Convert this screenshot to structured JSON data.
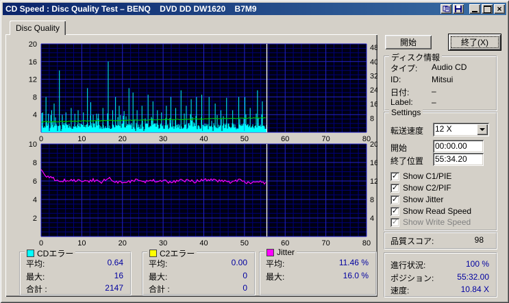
{
  "window": {
    "title": "CD Speed : Disc Quality Test – BENQ    DVD DD DW1620    B7M9"
  },
  "titlebar": {
    "buttons": [
      "book",
      "save",
      "minimize",
      "maximize",
      "close"
    ]
  },
  "tab": {
    "label": "Disc Quality"
  },
  "actions": {
    "start_label": "開始",
    "exit_label": "終了(X)"
  },
  "disc_info": {
    "title": "ディスク情報",
    "rows": [
      {
        "label": "タイプ:",
        "value": "Audio CD"
      },
      {
        "label": "ID:",
        "value": "Mitsui"
      },
      {
        "label": "日付:",
        "value": "–"
      },
      {
        "label": "Label:",
        "value": "–"
      }
    ]
  },
  "settings": {
    "title": "Settings",
    "speed_label": "転送速度",
    "speed_value": "12 X",
    "start_label": "開始",
    "start_value": "00:00.00",
    "end_label": "終了位置",
    "end_value": "55:34.20",
    "checkboxes": [
      {
        "label": "Show C1/PIE",
        "checked": true,
        "enabled": true
      },
      {
        "label": "Show C2/PIF",
        "checked": true,
        "enabled": true
      },
      {
        "label": "Show Jitter",
        "checked": true,
        "enabled": true
      },
      {
        "label": "Show Read Speed",
        "checked": true,
        "enabled": true
      },
      {
        "label": "Show Write Speed",
        "checked": true,
        "enabled": false
      }
    ]
  },
  "quality": {
    "label": "品質スコア:",
    "value": "98"
  },
  "progress": {
    "rows": [
      {
        "label": "進行状況:",
        "value": "100 %"
      },
      {
        "label": "ポジション:",
        "value": "55:32.00"
      },
      {
        "label": "速度:",
        "value": "10.84 X"
      }
    ]
  },
  "legends": [
    {
      "title": "CDエラー",
      "swatch": "#00ffff",
      "rows": [
        {
          "label": "平均:",
          "value": "0.64"
        },
        {
          "label": "最大:",
          "value": "16"
        },
        {
          "label": "合計 :",
          "value": "2147"
        }
      ]
    },
    {
      "title": "C2エラー",
      "swatch": "#ffff00",
      "rows": [
        {
          "label": "平均:",
          "value": "0.00"
        },
        {
          "label": "最大:",
          "value": "0"
        },
        {
          "label": "合計 :",
          "value": "0"
        }
      ]
    },
    {
      "title": "Jitter",
      "swatch": "#ff00ff",
      "rows": [
        {
          "label": "平均:",
          "value": "11.46 %"
        },
        {
          "label": "最大:",
          "value": "16.0 %"
        }
      ]
    }
  ],
  "chart_colors": {
    "plot_bg": "#000014",
    "grid_minor": "#000078",
    "grid_major": "#2222c8",
    "bars": "#00ffff",
    "read_speed": "#00c000",
    "jitter": "#ff00ff",
    "cursor": "#ffffff",
    "axis_text": "#000000"
  },
  "chart_data": [
    {
      "type": "bar",
      "name": "c1_errors_with_read_speed",
      "x_axis": {
        "range": [
          0,
          80
        ],
        "ticks": [
          0,
          10,
          20,
          30,
          40,
          50,
          60,
          70,
          80
        ],
        "minor_step": 2
      },
      "y_left": {
        "range": [
          0,
          20
        ],
        "ticks": [
          4,
          8,
          12,
          16,
          20
        ],
        "minor_step": 1
      },
      "y_right": {
        "range": [
          0,
          50
        ],
        "ticks": [
          8,
          16,
          24,
          32,
          40,
          48
        ]
      },
      "cursor_x": 55.5,
      "series": [
        {
          "name": "C1/CD errors",
          "type": "bar",
          "color_key": "bars",
          "data_end": 55.5,
          "base_range": [
            0.7,
            2.1
          ],
          "spikes": [
            [
              0.4,
              4.5
            ],
            [
              1.2,
              8
            ],
            [
              1.8,
              4.2
            ],
            [
              2.6,
              5
            ],
            [
              3.2,
              6.5
            ],
            [
              4.5,
              14
            ],
            [
              5.2,
              4
            ],
            [
              6.1,
              4.5
            ],
            [
              7.4,
              5.5
            ],
            [
              8.3,
              4.2
            ],
            [
              9.1,
              5
            ],
            [
              10.4,
              4.5
            ],
            [
              11.4,
              10
            ],
            [
              12.2,
              6.8
            ],
            [
              12.8,
              4
            ],
            [
              14.1,
              4.2
            ],
            [
              15.2,
              5.5
            ],
            [
              16.5,
              16
            ],
            [
              17.6,
              5
            ],
            [
              18.3,
              8
            ],
            [
              19.2,
              6
            ],
            [
              20.4,
              4.8
            ],
            [
              21.6,
              10
            ],
            [
              22.6,
              9
            ],
            [
              23.6,
              5
            ],
            [
              24.8,
              6
            ],
            [
              26.3,
              8.5
            ],
            [
              27.5,
              7
            ],
            [
              28.6,
              5
            ],
            [
              29.6,
              4.5
            ],
            [
              30.8,
              6
            ],
            [
              31.9,
              8
            ],
            [
              33.1,
              5.5
            ],
            [
              34.4,
              9.5
            ],
            [
              35.7,
              6
            ],
            [
              36.9,
              7.5
            ],
            [
              38.2,
              8
            ],
            [
              39.5,
              8.5
            ],
            [
              41.3,
              8
            ],
            [
              42.8,
              6.5
            ],
            [
              44.2,
              5
            ],
            [
              45.6,
              7.8
            ],
            [
              47.1,
              5
            ],
            [
              48.6,
              8
            ],
            [
              50.1,
              8
            ],
            [
              51.4,
              5.5
            ],
            [
              53.2,
              9.5
            ],
            [
              54.4,
              7
            ]
          ]
        },
        {
          "name": "Read speed",
          "type": "line",
          "color_key": "read_speed",
          "noise": 0.05,
          "points": [
            [
              0,
              2.35
            ],
            [
              10,
              2.55
            ],
            [
              20,
              2.72
            ],
            [
              30,
              2.88
            ],
            [
              40,
              3.02
            ],
            [
              50,
              3.2
            ],
            [
              55.5,
              3.3
            ]
          ]
        }
      ]
    },
    {
      "type": "line",
      "name": "jitter",
      "x_axis": {
        "range": [
          0,
          80
        ],
        "ticks": [
          0,
          10,
          20,
          30,
          40,
          50,
          60,
          70,
          80
        ],
        "minor_step": 2
      },
      "y_left": {
        "range": [
          0,
          10
        ],
        "ticks": [
          2,
          4,
          6,
          8,
          10
        ],
        "minor_step": 0.5
      },
      "y_right": {
        "range": [
          0,
          20
        ],
        "ticks": [
          4,
          8,
          12,
          16,
          20
        ]
      },
      "cursor_x": 55.5,
      "series": [
        {
          "name": "Jitter",
          "type": "line",
          "color_key": "jitter",
          "noise": 0.09,
          "points": [
            [
              0,
              7.2
            ],
            [
              0.8,
              6.7
            ],
            [
              1.5,
              6.5
            ],
            [
              2.5,
              6.3
            ],
            [
              3.5,
              6.15
            ],
            [
              5,
              6.0
            ],
            [
              7,
              6.1
            ],
            [
              9,
              6.05
            ],
            [
              11,
              5.95
            ],
            [
              13,
              6.1
            ],
            [
              15,
              5.85
            ],
            [
              16,
              6.2
            ],
            [
              17,
              6.3
            ],
            [
              18,
              5.85
            ],
            [
              20,
              5.95
            ],
            [
              22,
              6.0
            ],
            [
              24,
              6.1
            ],
            [
              25,
              5.88
            ],
            [
              27,
              6.0
            ],
            [
              29,
              6.05
            ],
            [
              31,
              5.9
            ],
            [
              33,
              6.0
            ],
            [
              35,
              6.05
            ],
            [
              37,
              5.95
            ],
            [
              39,
              6.0
            ],
            [
              41,
              6.1
            ],
            [
              43,
              6.05
            ],
            [
              45,
              6.0
            ],
            [
              47,
              5.9
            ],
            [
              49,
              6.1
            ],
            [
              51,
              5.8
            ],
            [
              53,
              5.95
            ],
            [
              55,
              5.75
            ],
            [
              55.5,
              5.7
            ]
          ]
        }
      ]
    }
  ]
}
